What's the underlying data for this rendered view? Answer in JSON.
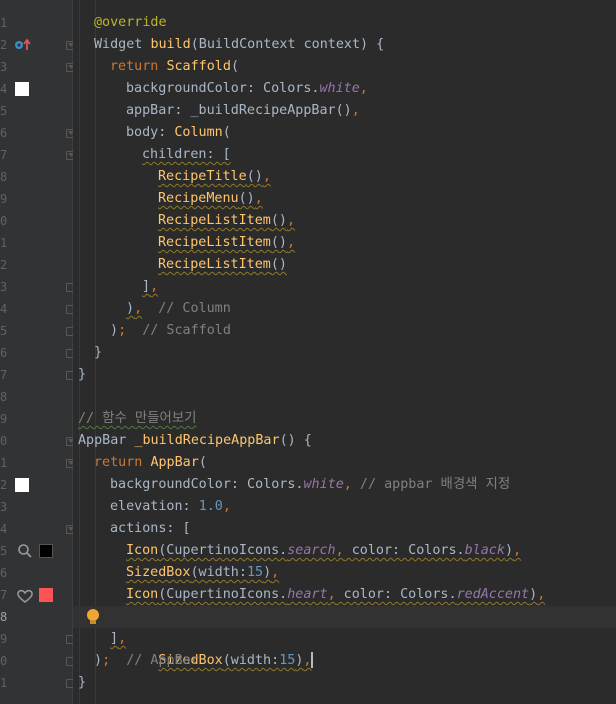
{
  "gutter": {
    "line_numbers": [
      "1",
      "2",
      "3",
      "4",
      "5",
      "6",
      "7",
      "8",
      "9",
      "0",
      "1",
      "2",
      "3",
      "4",
      "5",
      "6",
      "7",
      "8",
      "9",
      "0",
      "1",
      "2",
      "3",
      "4",
      "5",
      "6",
      "7",
      "8",
      "9",
      "0",
      "1"
    ],
    "current_line_index": 27,
    "swatch_colors": {
      "white": "#ffffff",
      "black": "#000000",
      "redAccent": "#ff5252"
    },
    "icons": {
      "override": "override-up-arrow-icon",
      "search": "search-icon",
      "heart": "heart-icon",
      "bulb": "lightbulb-icon"
    }
  },
  "code": {
    "l0": {
      "ann": "@override"
    },
    "l1": {
      "t1": "Widget ",
      "fn": "build",
      "t2": "(BuildContext context) {"
    },
    "l2": {
      "kw": "return ",
      "cls": "Scaffold",
      "t": "("
    },
    "l3": {
      "t1": "backgroundColor: Colors.",
      "it": "white",
      "kw": ","
    },
    "l4": {
      "t1": "appBar: _buildRecipeAppBar()",
      "kw": ","
    },
    "l5": {
      "t1": "body: ",
      "cls": "Column",
      "t": "("
    },
    "l6": {
      "t": "children: ["
    },
    "l7": {
      "cls": "RecipeTitle",
      "t": "()",
      "kw": ","
    },
    "l8": {
      "cls": "RecipeMenu",
      "t": "()",
      "kw": ","
    },
    "l9": {
      "cls": "RecipeListItem",
      "t": "()",
      "kw": ","
    },
    "l10": {
      "cls": "RecipeListItem",
      "t": "()",
      "kw": ","
    },
    "l11": {
      "cls": "RecipeListItem",
      "t": "()"
    },
    "l12": {
      "t": "]",
      "kw": ","
    },
    "l13": {
      "t": ")",
      "kw": ",",
      "cmt": "// Column"
    },
    "l14": {
      "t": ")",
      "kw": ";",
      "cmt": "// Scaffold"
    },
    "l15": {
      "t": "}"
    },
    "l16": {
      "t": "}"
    },
    "l17": {
      "t": ""
    },
    "l18": {
      "cmt": "// 함수 만들어보기"
    },
    "l19": {
      "t1": "AppBar ",
      "fn": "_buildRecipeAppBar",
      "t2": "() {"
    },
    "l20": {
      "kw": "return ",
      "cls": "AppBar",
      "t": "("
    },
    "l21": {
      "t1": "backgroundColor: Colors.",
      "it": "white",
      "kw": ",",
      "cmt": "// appbar 배경색 지정"
    },
    "l22": {
      "t1": "elevation: ",
      "num": "1.0",
      "kw": ","
    },
    "l23": {
      "t": "actions: ["
    },
    "l24": {
      "cls": "Icon",
      "t1": "(CupertinoIcons.",
      "it": "search",
      "kw1": ",",
      "t2": " color: Colors.",
      "it2": "black",
      "t3": ")",
      "kw2": ","
    },
    "l25": {
      "cls": "SizedBox",
      "t1": "(width:",
      "num": "15",
      "t2": ")",
      "kw": ","
    },
    "l26": {
      "cls": "Icon",
      "t1": "(CupertinoIcons.",
      "it": "heart",
      "kw1": ",",
      "t2": " color: Colors.",
      "it2": "redAccent",
      "t3": ")",
      "kw2": ","
    },
    "l27": {
      "cls": "SizedBox",
      "t1": "(width:",
      "num": "15",
      "t2": ")",
      "kw": ","
    },
    "l28": {
      "t": "]",
      "kw": ","
    },
    "l29": {
      "t": ")",
      "kw": ";",
      "cmt": "// AppBar"
    },
    "l30": {
      "t": "}"
    }
  }
}
